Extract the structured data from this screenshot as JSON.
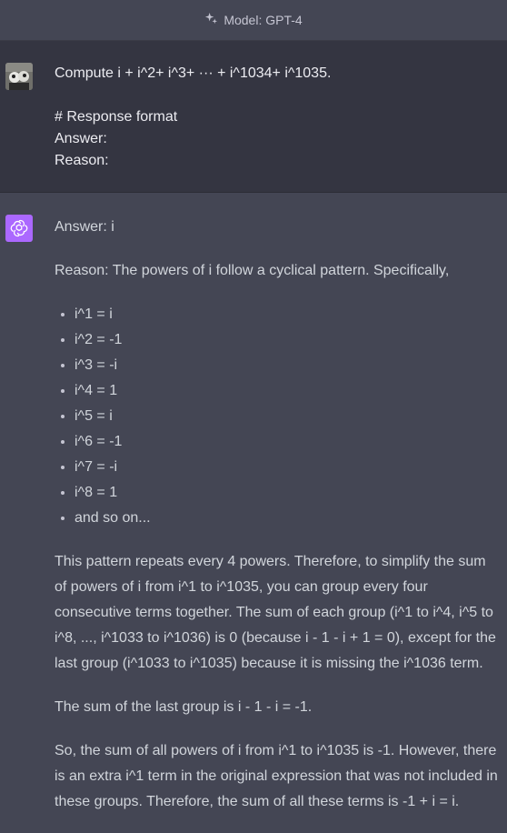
{
  "header": {
    "model_label": "Model: GPT-4"
  },
  "user_message": {
    "line1": "Compute i + i^2+ i^3+ ··· + i^1034+ i^1035.",
    "line2": "# Response format",
    "line3": "Answer:",
    "line4": "Reason:"
  },
  "assistant_message": {
    "answer": "Answer: i",
    "reason_intro": "Reason: The powers of i follow a cyclical pattern. Specifically,",
    "list": [
      "i^1 = i",
      "i^2 = -1",
      "i^3 = -i",
      "i^4 = 1",
      "i^5 = i",
      "i^6 = -1",
      "i^7 = -i",
      "i^8 = 1",
      "and so on..."
    ],
    "para1": "This pattern repeats every 4 powers. Therefore, to simplify the sum of powers of i from i^1 to i^1035, you can group every four consecutive terms together. The sum of each group (i^1 to i^4, i^5 to i^8, ..., i^1033 to i^1036) is 0 (because i - 1 - i + 1 = 0), except for the last group (i^1033 to i^1035) because it is missing the i^1036 term.",
    "para2": "The sum of the last group is i - 1 - i = -1.",
    "para3": "So, the sum of all powers of i from i^1 to i^1035 is -1. However, there is an extra i^1 term in the original expression that was not included in these groups. Therefore, the sum of all these terms is -1 + i = i."
  },
  "colors": {
    "user_bg": "#343541",
    "assistant_bg": "#444654",
    "gpt_logo_bg": "#ab68ff"
  }
}
